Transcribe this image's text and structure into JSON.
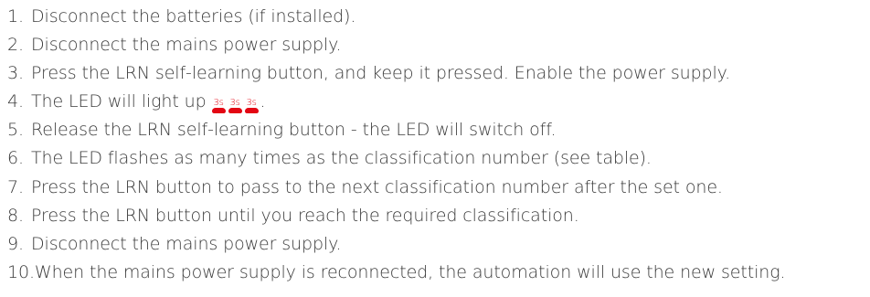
{
  "steps": [
    {
      "number": "1.",
      "text": "Disconnect the batteries (if installed)."
    },
    {
      "number": "2.",
      "text": "Disconnect the mains power supply."
    },
    {
      "number": "3.",
      "text": "Press the LRN self-learning button, and keep it pressed. Enable the power supply."
    },
    {
      "number": "4.",
      "text": "The LED will light up",
      "after_leds": "."
    },
    {
      "number": "5.",
      "text": "Release the LRN self-learning button - the LED will switch off."
    },
    {
      "number": "6.",
      "text": "The LED flashes as many times as the classification number (see table)."
    },
    {
      "number": "7.",
      "text": "Press the LRN button to pass to the next classification number after the set one."
    },
    {
      "number": "8.",
      "text": "Press the LRN button until you reach the required classification."
    },
    {
      "number": "9.",
      "text": "Disconnect the mains power supply."
    },
    {
      "number": "10.",
      "text": "When the mains power supply is reconnected, the automation will use the new setting."
    }
  ],
  "led_indicators": [
    {
      "label": "3s",
      "color": "#e30613"
    },
    {
      "label": "3s",
      "color": "#e30613"
    },
    {
      "label": "3s",
      "color": "#e30613"
    }
  ]
}
